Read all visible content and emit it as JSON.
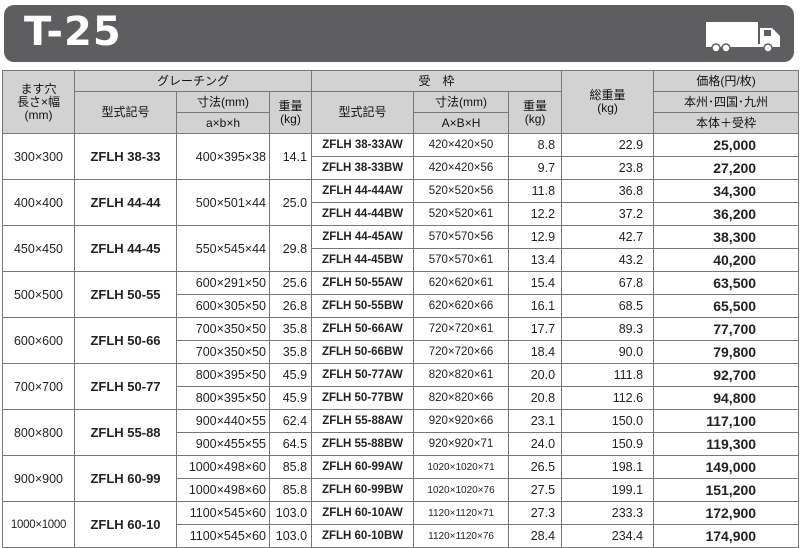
{
  "title": "T-25",
  "header": {
    "hole_size": "ます穴\n長さ×幅\n(mm)",
    "grating": "グレーチング",
    "grating_model": "型式記号",
    "grating_dim": "寸法(mm)",
    "grating_dim_sub": "a×b×h",
    "grating_weight": "重量\n(kg)",
    "receiver": "受　枠",
    "receiver_model": "型式記号",
    "receiver_dim": "寸法(mm)",
    "receiver_dim_sub": "A×B×H",
    "receiver_weight": "重量\n(kg)",
    "total_weight": "総重量\n(kg)",
    "price": "価格(円/枚)",
    "price_region": "本州･四国･九州",
    "price_sub": "本体＋受枠"
  },
  "groups": [
    {
      "size": "300×300",
      "model": "ZFLH 38-33",
      "rows": [
        {
          "dim": "400×395×38",
          "weight": "14.1",
          "rmodel": "ZFLH 38-33AW",
          "rdim": "420×420×50",
          "rweight": "8.8",
          "total": "22.9",
          "price": "25,000"
        },
        {
          "dim": "",
          "weight": "",
          "rmodel": "ZFLH 38-33BW",
          "rdim": "420×420×56",
          "rweight": "9.7",
          "total": "23.8",
          "price": "27,200"
        }
      ],
      "grating_span": true
    },
    {
      "size": "400×400",
      "model": "ZFLH 44-44",
      "rows": [
        {
          "dim": "500×501×44",
          "weight": "25.0",
          "rmodel": "ZFLH 44-44AW",
          "rdim": "520×520×56",
          "rweight": "11.8",
          "total": "36.8",
          "price": "34,300"
        },
        {
          "dim": "",
          "weight": "",
          "rmodel": "ZFLH 44-44BW",
          "rdim": "520×520×61",
          "rweight": "12.2",
          "total": "37.2",
          "price": "36,200"
        }
      ],
      "grating_span": true
    },
    {
      "size": "450×450",
      "model": "ZFLH 44-45",
      "rows": [
        {
          "dim": "550×545×44",
          "weight": "29.8",
          "rmodel": "ZFLH 44-45AW",
          "rdim": "570×570×56",
          "rweight": "12.9",
          "total": "42.7",
          "price": "38,300"
        },
        {
          "dim": "",
          "weight": "",
          "rmodel": "ZFLH 44-45BW",
          "rdim": "570×570×61",
          "rweight": "13.4",
          "total": "43.2",
          "price": "40,200"
        }
      ],
      "grating_span": true
    },
    {
      "size": "500×500",
      "model": "ZFLH 50-55",
      "rows": [
        {
          "dim": "600×291×50",
          "weight": "25.6",
          "rmodel": "ZFLH 50-55AW",
          "rdim": "620×620×61",
          "rweight": "15.4",
          "total": "67.8",
          "price": "63,500"
        },
        {
          "dim": "600×305×50",
          "weight": "26.8",
          "rmodel": "ZFLH 50-55BW",
          "rdim": "620×620×66",
          "rweight": "16.1",
          "total": "68.5",
          "price": "65,500"
        }
      ],
      "grating_span": false
    },
    {
      "size": "600×600",
      "model": "ZFLH 50-66",
      "rows": [
        {
          "dim": "700×350×50",
          "weight": "35.8",
          "rmodel": "ZFLH 50-66AW",
          "rdim": "720×720×61",
          "rweight": "17.7",
          "total": "89.3",
          "price": "77,700"
        },
        {
          "dim": "700×350×50",
          "weight": "35.8",
          "rmodel": "ZFLH 50-66BW",
          "rdim": "720×720×66",
          "rweight": "18.4",
          "total": "90.0",
          "price": "79,800"
        }
      ],
      "grating_span": false
    },
    {
      "size": "700×700",
      "model": "ZFLH 50-77",
      "rows": [
        {
          "dim": "800×395×50",
          "weight": "45.9",
          "rmodel": "ZFLH 50-77AW",
          "rdim": "820×820×61",
          "rweight": "20.0",
          "total": "111.8",
          "price": "92,700"
        },
        {
          "dim": "800×395×50",
          "weight": "45.9",
          "rmodel": "ZFLH 50-77BW",
          "rdim": "820×820×66",
          "rweight": "20.8",
          "total": "112.6",
          "price": "94,800"
        }
      ],
      "grating_span": false
    },
    {
      "size": "800×800",
      "model": "ZFLH 55-88",
      "rows": [
        {
          "dim": "900×440×55",
          "weight": "62.4",
          "rmodel": "ZFLH 55-88AW",
          "rdim": "920×920×66",
          "rweight": "23.1",
          "total": "150.0",
          "price": "117,100"
        },
        {
          "dim": "900×455×55",
          "weight": "64.5",
          "rmodel": "ZFLH 55-88BW",
          "rdim": "920×920×71",
          "rweight": "24.0",
          "total": "150.9",
          "price": "119,300"
        }
      ],
      "grating_span": false
    },
    {
      "size": "900×900",
      "model": "ZFLH 60-99",
      "rows": [
        {
          "dim": "1000×498×60",
          "weight": "85.8",
          "rmodel": "ZFLH 60-99AW",
          "rdim": "1020×1020×71",
          "rweight": "26.5",
          "total": "198.1",
          "price": "149,000"
        },
        {
          "dim": "1000×498×60",
          "weight": "85.8",
          "rmodel": "ZFLH 60-99BW",
          "rdim": "1020×1020×76",
          "rweight": "27.5",
          "total": "199.1",
          "price": "151,200"
        }
      ],
      "grating_span": false
    },
    {
      "size": "1000×1000",
      "model": "ZFLH 60-10",
      "rows": [
        {
          "dim": "1100×545×60",
          "weight": "103.0",
          "rmodel": "ZFLH 60-10AW",
          "rdim": "1120×1120×71",
          "rweight": "27.3",
          "total": "233.3",
          "price": "172,900"
        },
        {
          "dim": "1100×545×60",
          "weight": "103.0",
          "rmodel": "ZFLH 60-10BW",
          "rdim": "1120×1120×76",
          "rweight": "28.4",
          "total": "234.4",
          "price": "174,900"
        }
      ],
      "grating_span": false
    }
  ],
  "icons": {
    "truck": "truck-icon"
  },
  "colors": {
    "banner": "#5e5e60",
    "header_bg": "#d2d2d3",
    "border": "#777777"
  }
}
